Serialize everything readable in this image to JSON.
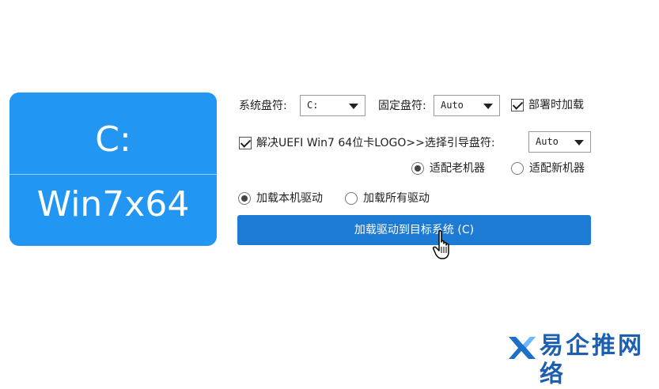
{
  "drive_tile": {
    "letter": "C:",
    "os": "Win7x64"
  },
  "options": {
    "system_drive_label": "系统盘符:",
    "system_drive_value": "C:",
    "fixed_drive_label": "固定盘符:",
    "fixed_drive_value": "Auto",
    "deploy_load_label": "部署时加载",
    "deploy_load_checked": true,
    "uefi_fix_label": "解决UEFI Win7 64位卡LOGO>>选择引导盘符:",
    "uefi_fix_checked": true,
    "boot_drive_value": "Auto",
    "adapt_old_label": "适配老机器",
    "adapt_new_label": "适配新机器",
    "adapt_selected": "old",
    "load_local_label": "加载本机驱动",
    "load_all_label": "加载所有驱动",
    "load_selected": "local"
  },
  "action": {
    "load_button_label": "加载驱动到目标系统 (C)"
  },
  "watermark": {
    "text": "易企推网络"
  },
  "colors": {
    "tile": "#2196f3",
    "button": "#1e7bd4",
    "watermark": "#1e5fb0"
  }
}
